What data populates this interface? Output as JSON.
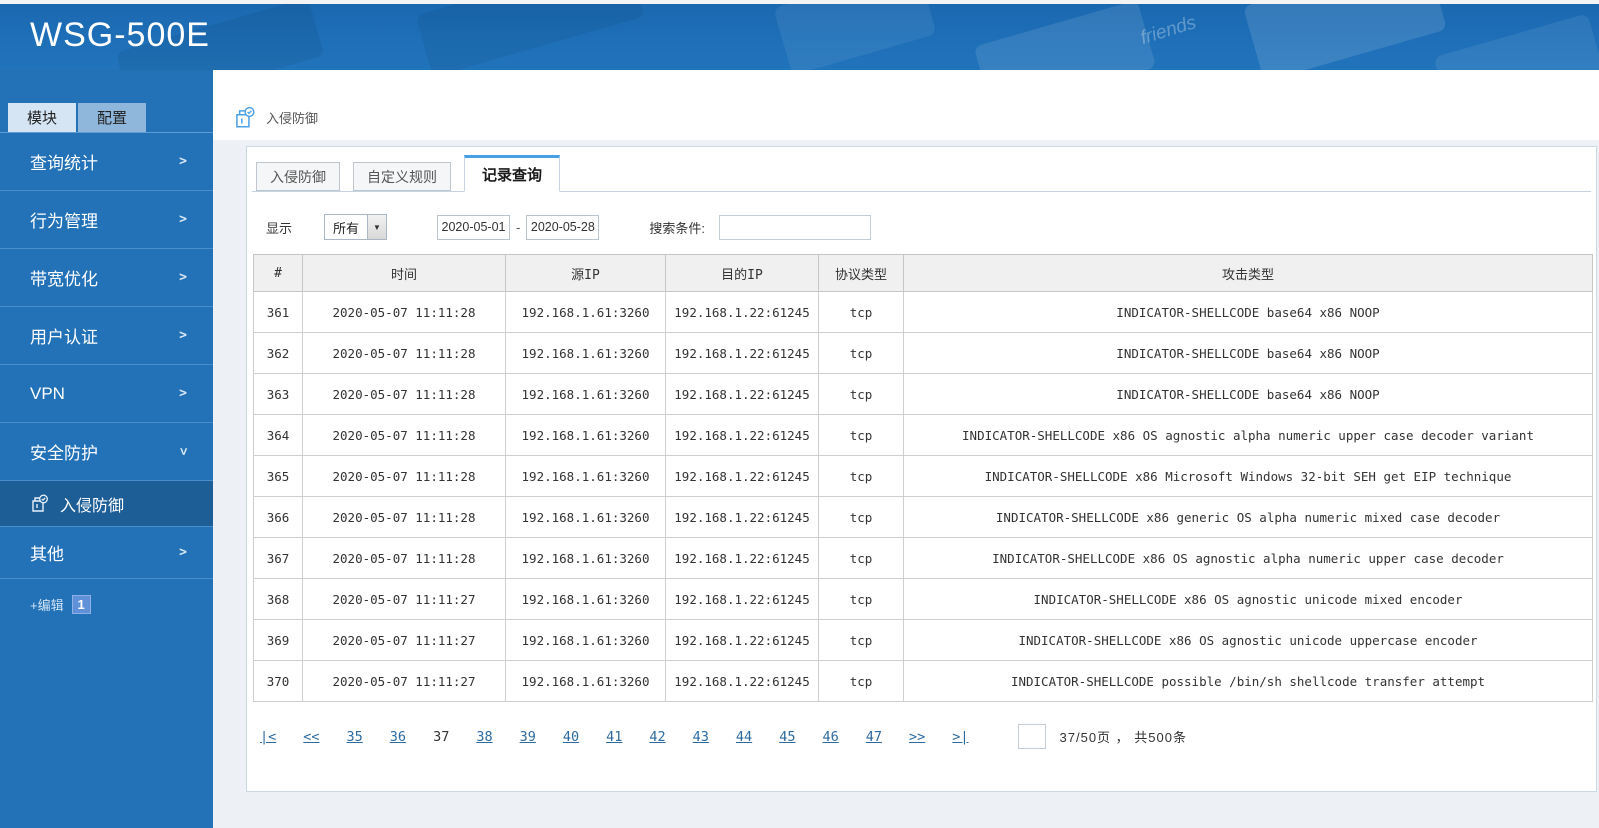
{
  "header": {
    "title": "WSG-500E",
    "keyboard_word": "friends"
  },
  "sidebar": {
    "tabs": [
      {
        "label": "模块"
      },
      {
        "label": "配置"
      }
    ],
    "items": [
      {
        "label": "查询统计"
      },
      {
        "label": "行为管理"
      },
      {
        "label": "带宽优化"
      },
      {
        "label": "用户认证"
      },
      {
        "label": "VPN"
      },
      {
        "label": "安全防护"
      },
      {
        "label": "其他"
      }
    ],
    "submenu": {
      "label": "入侵防御"
    },
    "edit": {
      "label": "+编辑",
      "badge": "1"
    }
  },
  "breadcrumb": {
    "label": "入侵防御"
  },
  "content": {
    "tabs": [
      {
        "label": "入侵防御"
      },
      {
        "label": "自定义规则"
      },
      {
        "label": "记录查询"
      }
    ],
    "filters": {
      "display_label": "显示",
      "display_value": "所有",
      "date_from": "2020-05-01",
      "date_sep": "-",
      "date_to": "2020-05-28",
      "search_label": "搜索条件:",
      "search_value": ""
    },
    "table": {
      "headers": [
        "#",
        "时间",
        "源IP",
        "目的IP",
        "协议类型",
        "攻击类型"
      ],
      "rows": [
        [
          "361",
          "2020-05-07 11:11:28",
          "192.168.1.61:3260",
          "192.168.1.22:61245",
          "tcp",
          "INDICATOR-SHELLCODE base64 x86 NOOP"
        ],
        [
          "362",
          "2020-05-07 11:11:28",
          "192.168.1.61:3260",
          "192.168.1.22:61245",
          "tcp",
          "INDICATOR-SHELLCODE base64 x86 NOOP"
        ],
        [
          "363",
          "2020-05-07 11:11:28",
          "192.168.1.61:3260",
          "192.168.1.22:61245",
          "tcp",
          "INDICATOR-SHELLCODE base64 x86 NOOP"
        ],
        [
          "364",
          "2020-05-07 11:11:28",
          "192.168.1.61:3260",
          "192.168.1.22:61245",
          "tcp",
          "INDICATOR-SHELLCODE x86 OS agnostic alpha numeric upper case decoder variant"
        ],
        [
          "365",
          "2020-05-07 11:11:28",
          "192.168.1.61:3260",
          "192.168.1.22:61245",
          "tcp",
          "INDICATOR-SHELLCODE x86 Microsoft Windows 32-bit SEH get EIP technique"
        ],
        [
          "366",
          "2020-05-07 11:11:28",
          "192.168.1.61:3260",
          "192.168.1.22:61245",
          "tcp",
          "INDICATOR-SHELLCODE x86 generic OS alpha numeric mixed case decoder"
        ],
        [
          "367",
          "2020-05-07 11:11:28",
          "192.168.1.61:3260",
          "192.168.1.22:61245",
          "tcp",
          "INDICATOR-SHELLCODE x86 OS agnostic alpha numeric upper case decoder"
        ],
        [
          "368",
          "2020-05-07 11:11:27",
          "192.168.1.61:3260",
          "192.168.1.22:61245",
          "tcp",
          "INDICATOR-SHELLCODE x86 OS agnostic unicode mixed encoder"
        ],
        [
          "369",
          "2020-05-07 11:11:27",
          "192.168.1.61:3260",
          "192.168.1.22:61245",
          "tcp",
          "INDICATOR-SHELLCODE x86 OS agnostic unicode uppercase encoder"
        ],
        [
          "370",
          "2020-05-07 11:11:27",
          "192.168.1.61:3260",
          "192.168.1.22:61245",
          "tcp",
          "INDICATOR-SHELLCODE possible /bin/sh shellcode transfer attempt"
        ]
      ]
    },
    "pagination": {
      "first": "|<",
      "prev": "<<",
      "pages": [
        "35",
        "36",
        "37",
        "38",
        "39",
        "40",
        "41",
        "42",
        "43",
        "44",
        "45",
        "46",
        "47"
      ],
      "current": "37",
      "next": ">>",
      "last": ">|",
      "jump_value": "",
      "status": "37/50页 ， 共500条"
    }
  },
  "icons": {
    "breadcrumb": "stamp-check-icon",
    "submenu": "stamp-check-icon",
    "dropdown": "caret-down-icon",
    "collapse": "caret-left-icon"
  },
  "colors": {
    "header_blue": "#1e6fb8",
    "sidebar_blue": "#2372b8",
    "submenu_selected": "#1d5e97",
    "tab_accent": "#47a0e6",
    "link_blue": "#2d6a9f",
    "page_bg": "#edf1f5"
  }
}
